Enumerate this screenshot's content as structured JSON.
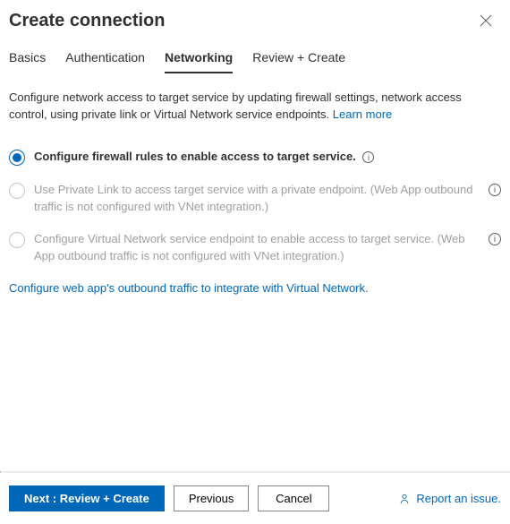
{
  "header": {
    "title": "Create connection"
  },
  "tabs": [
    {
      "label": "Basics",
      "active": false
    },
    {
      "label": "Authentication",
      "active": false
    },
    {
      "label": "Networking",
      "active": true
    },
    {
      "label": "Review + Create",
      "active": false
    }
  ],
  "description": {
    "text": "Configure network access to target service by updating firewall settings, network access control, using private link or Virtual Network service endpoints.",
    "learn_more": "Learn more"
  },
  "options": [
    {
      "label": "Configure firewall rules to enable access to target service.",
      "selected": true,
      "disabled": false,
      "info_inline": true,
      "info_right": false
    },
    {
      "label": "Use Private Link to access target service with a private endpoint. (Web App outbound traffic is not configured with VNet integration.)",
      "selected": false,
      "disabled": true,
      "info_inline": false,
      "info_right": true
    },
    {
      "label": "Configure Virtual Network service endpoint to enable access to target service. (Web App outbound traffic is not configured with VNet integration.)",
      "selected": false,
      "disabled": true,
      "info_inline": false,
      "info_right": true
    }
  ],
  "secondary_link": "Configure web app's outbound traffic to integrate with Virtual Network.",
  "footer": {
    "primary": "Next : Review + Create",
    "previous": "Previous",
    "cancel": "Cancel",
    "report": "Report an issue."
  }
}
